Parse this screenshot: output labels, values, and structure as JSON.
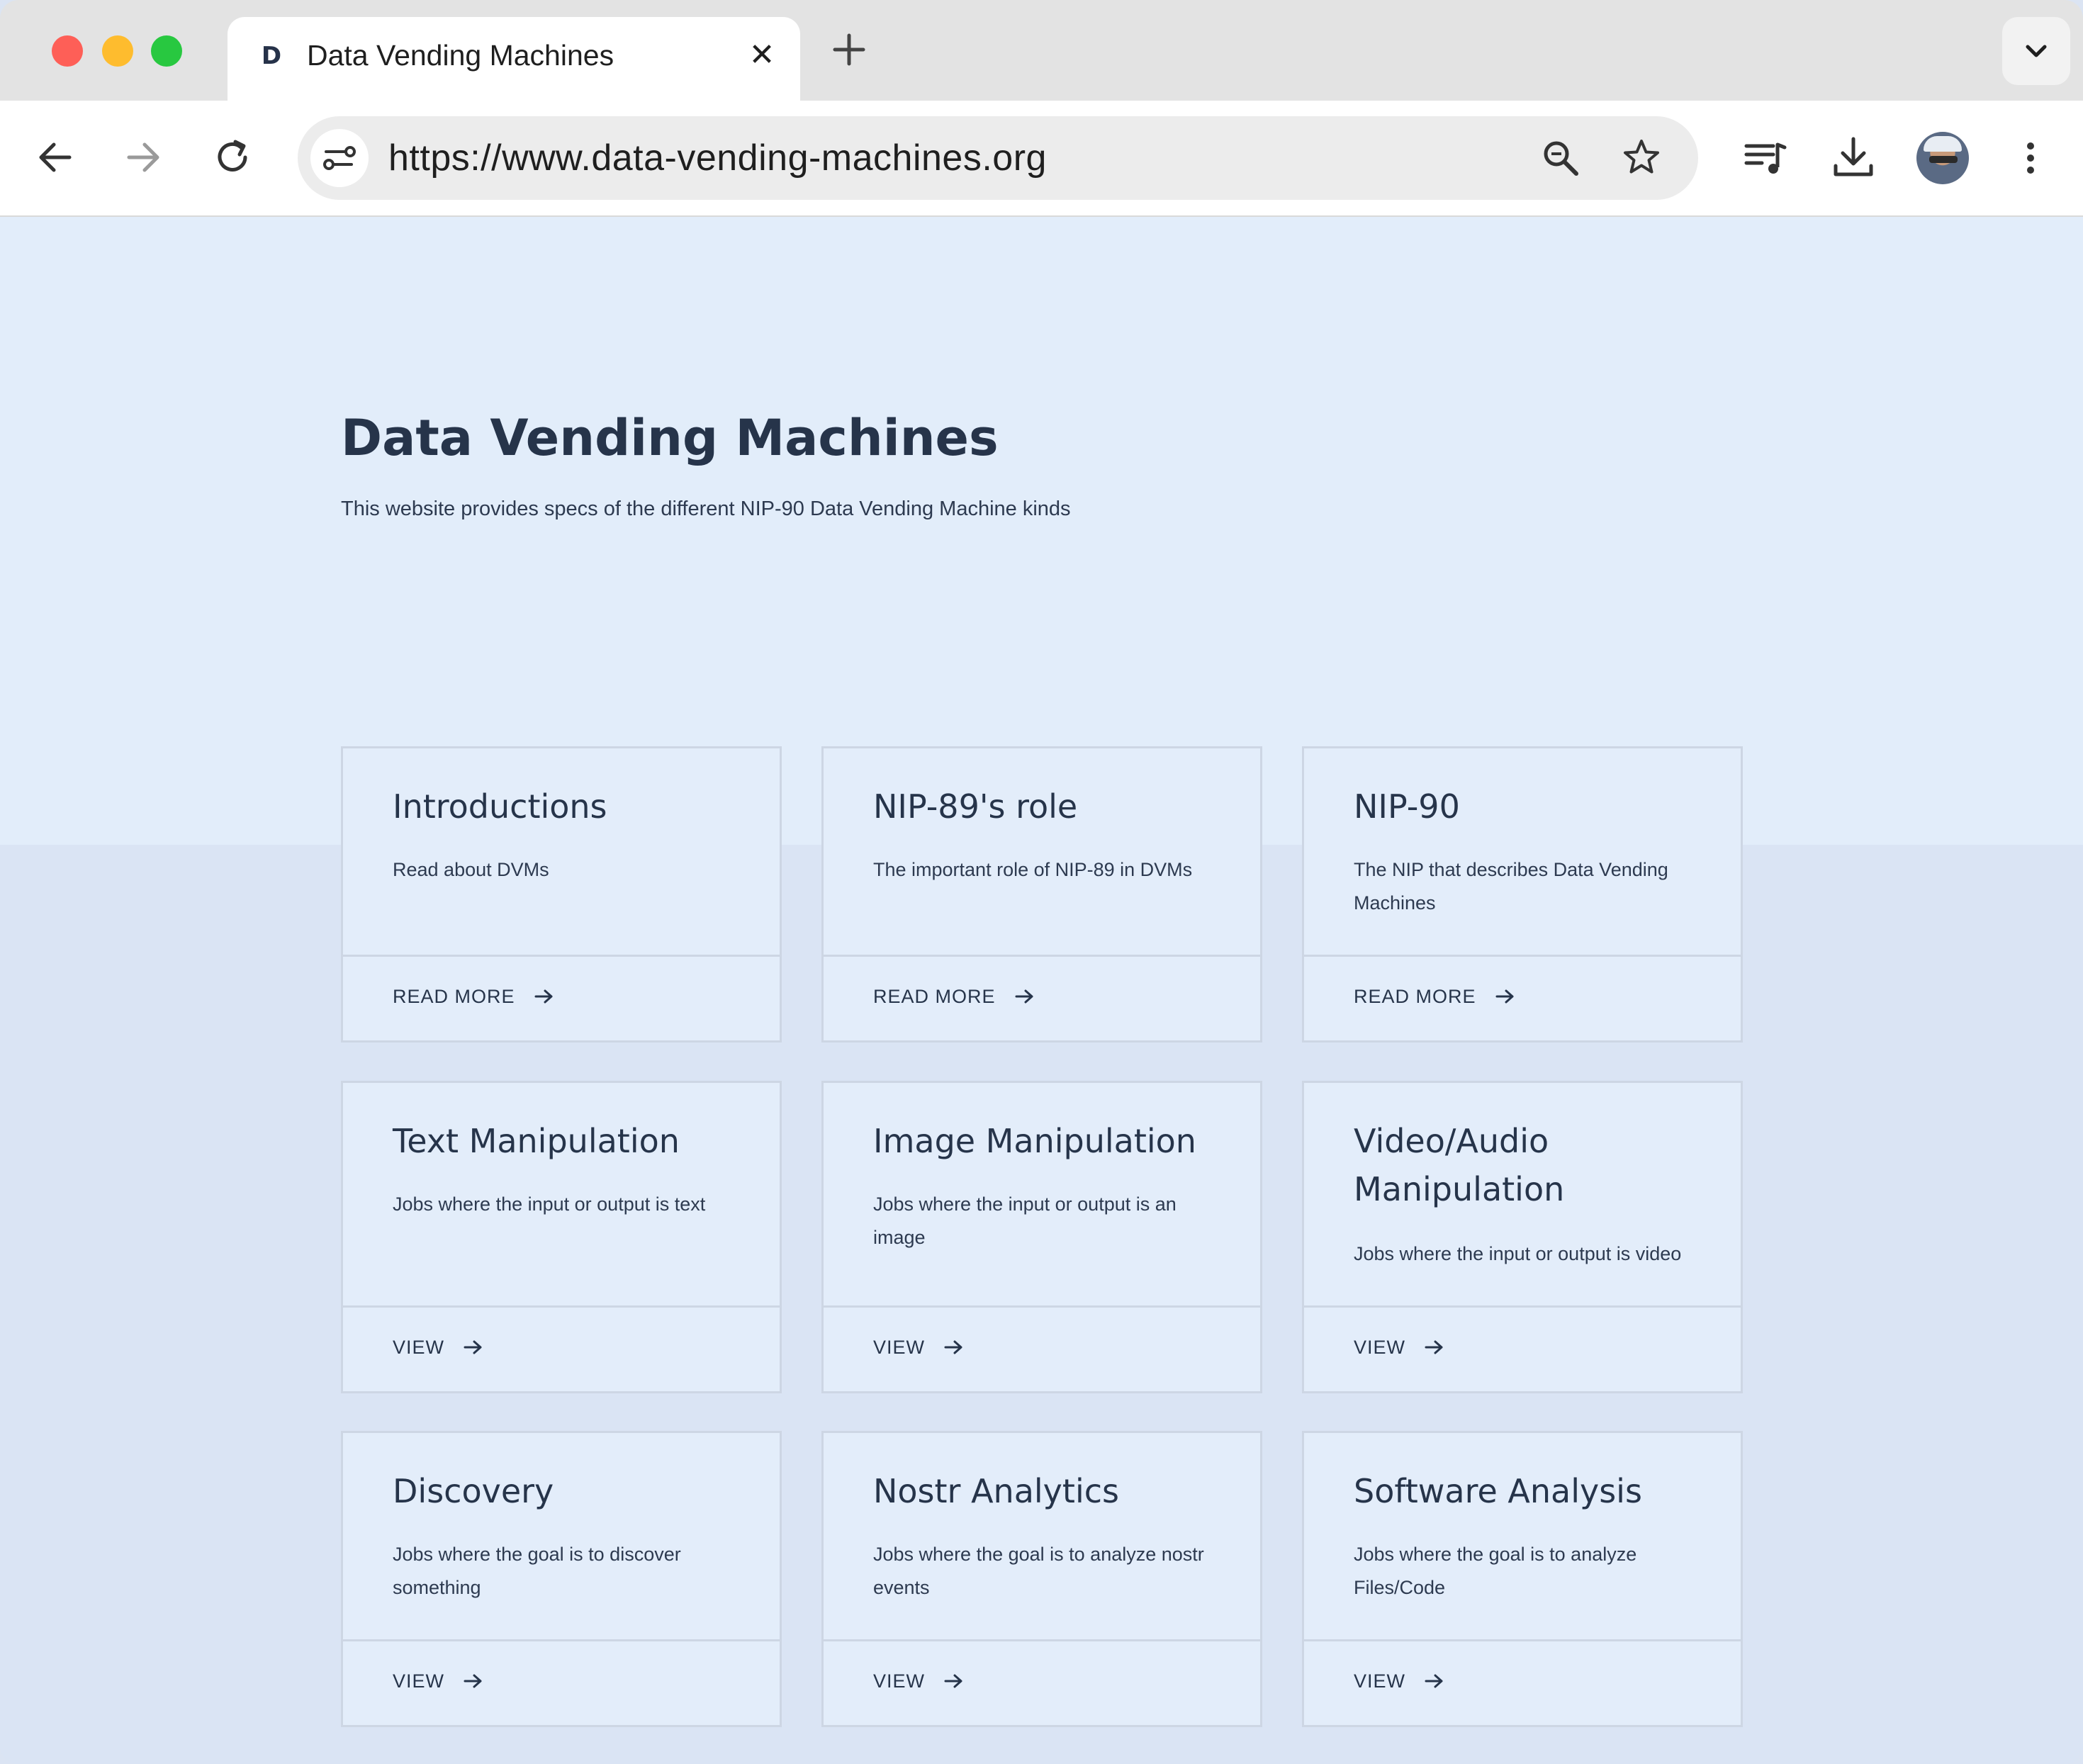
{
  "browser": {
    "tab": {
      "favicon": "D",
      "title": "Data Vending Machines",
      "close_icon": "close-icon"
    },
    "new_tab_icon": "plus-icon",
    "tab_search_icon": "chevron-down-icon",
    "url": "https://www.data-vending-machines.org",
    "toolbar_icons": [
      "back-arrow-icon",
      "forward-arrow-icon",
      "reload-icon",
      "site-info-icon",
      "zoom-icon",
      "bookmark-star-icon",
      "media-queue-icon",
      "download-icon",
      "avatar",
      "more-menu-icon"
    ]
  },
  "page": {
    "title": "Data Vending Machines",
    "subtitle": "This website provides specs of the different NIP-90 Data Vending Machine kinds"
  },
  "cards": [
    {
      "title": "Introductions",
      "desc": "Read about DVMs",
      "link": "READ MORE"
    },
    {
      "title": "NIP-89's role",
      "desc": "The important role of NIP-89 in DVMs",
      "link": "READ MORE"
    },
    {
      "title": "NIP-90",
      "desc": "The NIP that describes Data Vending Machines",
      "link": "READ MORE"
    },
    {
      "title": "Text Manipulation",
      "desc": "Jobs where the input or output is text",
      "link": "VIEW"
    },
    {
      "title": "Image Manipulation",
      "desc": "Jobs where the input or output is an image",
      "link": "VIEW"
    },
    {
      "title": "Video/Audio Manipulation",
      "desc": "Jobs where the input or output is video",
      "link": "VIEW"
    },
    {
      "title": "Discovery",
      "desc": "Jobs where the goal is to discover something",
      "link": "VIEW"
    },
    {
      "title": "Nostr Analytics",
      "desc": "Jobs where the goal is to analyze nostr events",
      "link": "VIEW"
    },
    {
      "title": "Software Analysis",
      "desc": "Jobs where the goal is to analyze Files/Code",
      "link": "VIEW"
    }
  ],
  "colors": {
    "hero_bg": "#e2edfa",
    "page_bg": "#dae4f4",
    "card_border": "#cdd6e4",
    "heading": "#26344a"
  }
}
